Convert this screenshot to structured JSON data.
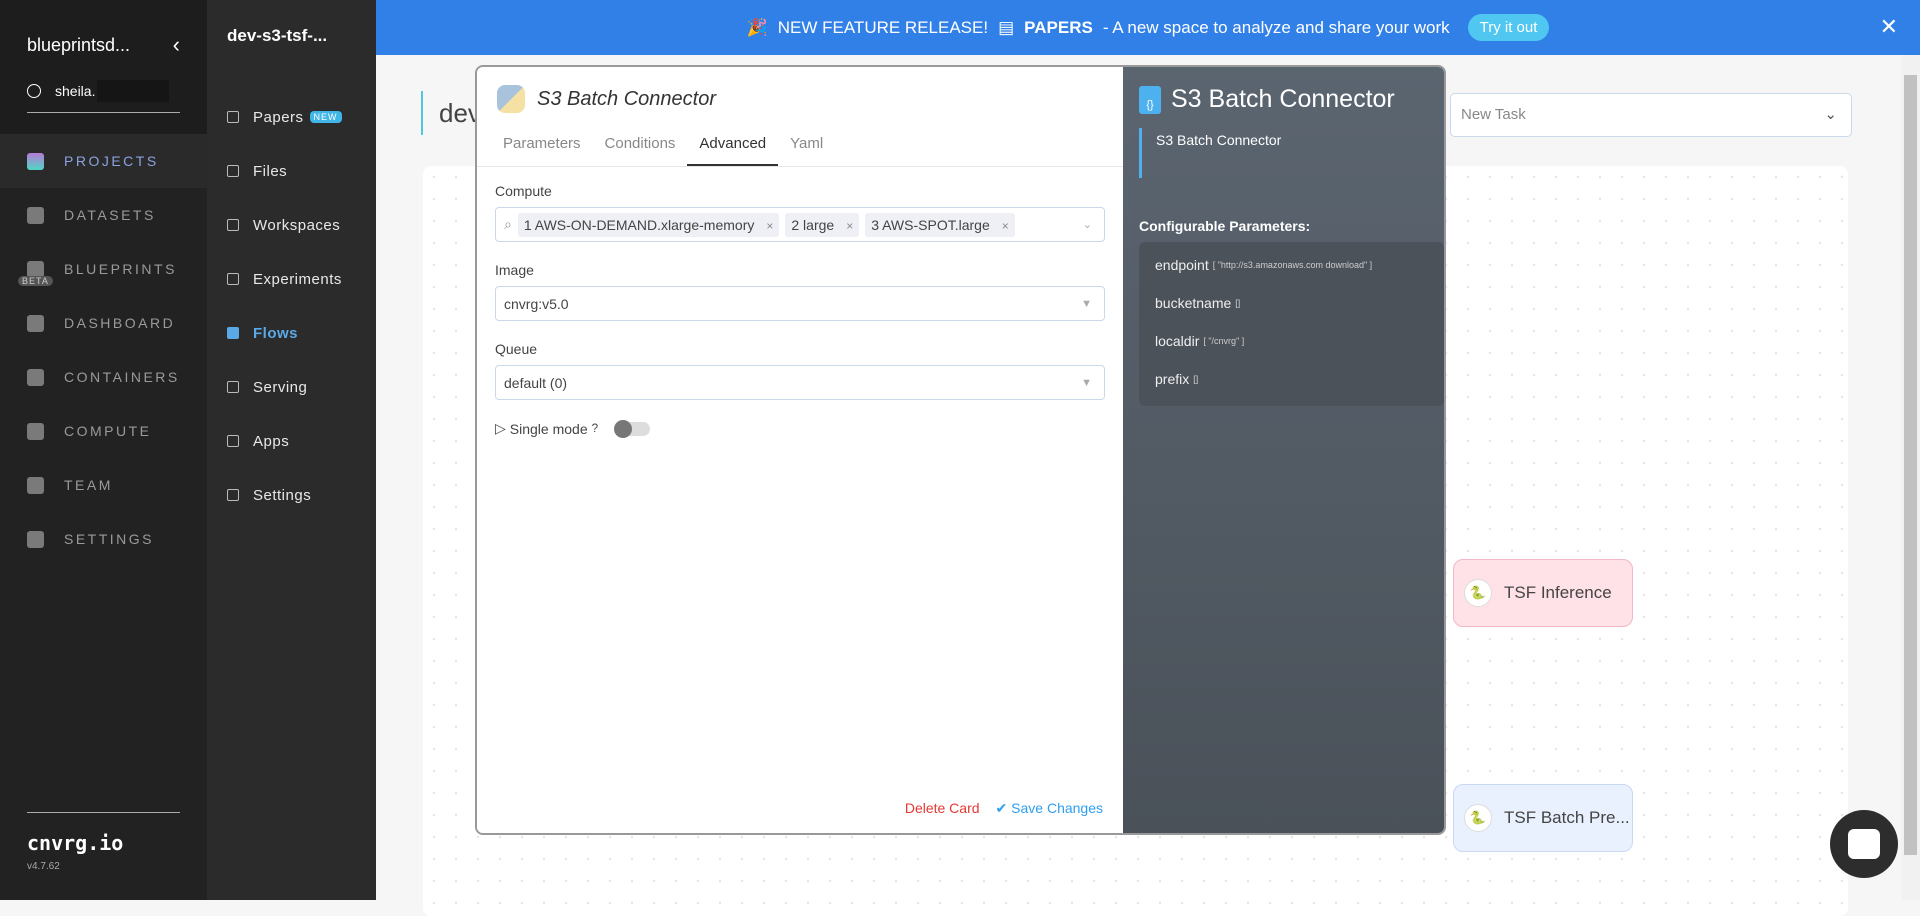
{
  "sidebar": {
    "org": "blueprintsd...",
    "user": "sheila.",
    "items": [
      {
        "label": "PROJECTS",
        "active": true
      },
      {
        "label": "DATASETS"
      },
      {
        "label": "BLUEPRINTS",
        "badge": "BETA"
      },
      {
        "label": "DASHBOARD"
      },
      {
        "label": "CONTAINERS"
      },
      {
        "label": "COMPUTE"
      },
      {
        "label": "TEAM"
      },
      {
        "label": "SETTINGS"
      }
    ],
    "brand": "cnvrg.io",
    "version": "v4.7.62"
  },
  "subnav": {
    "project": "dev-s3-tsf-...",
    "items": [
      {
        "label": "Papers",
        "badge": "NEW"
      },
      {
        "label": "Files"
      },
      {
        "label": "Workspaces"
      },
      {
        "label": "Experiments"
      },
      {
        "label": "Flows",
        "active": true
      },
      {
        "label": "Serving"
      },
      {
        "label": "Apps"
      },
      {
        "label": "Settings"
      }
    ]
  },
  "banner": {
    "release": "NEW FEATURE RELEASE!",
    "papers": "PAPERS",
    "text": "- A new space to analyze and share your work",
    "cta": "Try it out"
  },
  "main": {
    "title": "dev",
    "new_task": "New Task",
    "nodes": [
      "TSF Inference",
      "TSF Batch Pre..."
    ]
  },
  "modal": {
    "title": "S3 Batch Connector",
    "tabs": [
      "Parameters",
      "Conditions",
      "Advanced",
      "Yaml"
    ],
    "active_tab": "Advanced",
    "compute_label": "Compute",
    "compute_tags": [
      "1 AWS-ON-DEMAND.xlarge-memory",
      "2 large",
      "3 AWS-SPOT.large"
    ],
    "image_label": "Image",
    "image_value": "cnvrg:v5.0",
    "queue_label": "Queue",
    "queue_value": "default (0)",
    "single_mode": "Single mode",
    "delete": "Delete Card",
    "save": "Save Changes"
  },
  "info": {
    "title": "S3 Batch Connector",
    "description": "S3 Batch Connector",
    "params_heading": "Configurable Parameters:",
    "params": [
      {
        "name": "endpoint",
        "value": "[ \"http://s3.amazonaws.com download\" ]"
      },
      {
        "name": "bucketname",
        "value": "[]"
      },
      {
        "name": "localdir",
        "value": "[ \"/cnvrg\" ]"
      },
      {
        "name": "prefix",
        "value": "[]"
      }
    ]
  }
}
